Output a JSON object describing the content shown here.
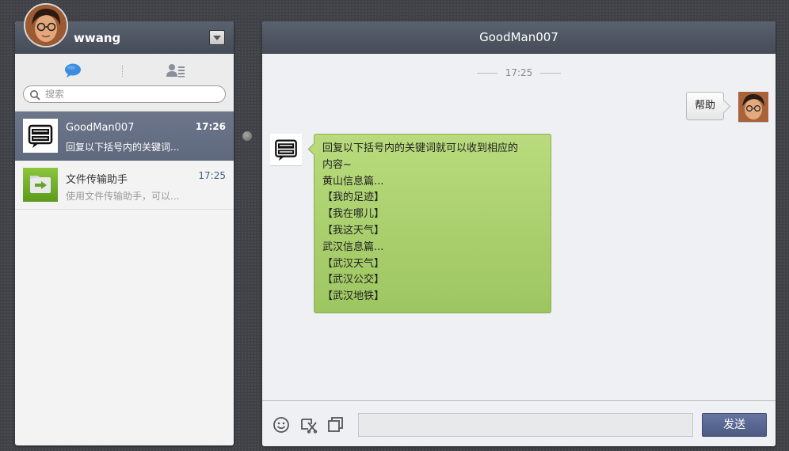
{
  "user": {
    "name": "wwang",
    "avatar_icon": "user-photo-avatar"
  },
  "search": {
    "placeholder": "搜索"
  },
  "tabs": [
    {
      "name": "chat",
      "icon": "speech-bubble-icon",
      "color": "#3b8de0"
    },
    {
      "name": "contacts",
      "icon": "contacts-list-icon",
      "color": "#8a8f99"
    }
  ],
  "conversations": [
    {
      "name": "GoodMan007",
      "time": "17:26",
      "preview": "回复以下括号内的关键词...",
      "avatar_icon": "hello-world-logo",
      "active": true
    },
    {
      "name": "文件传输助手",
      "time": "17:25",
      "preview": "使用文件传输助手，可以...",
      "avatar_icon": "file-transfer-icon",
      "active": false
    }
  ],
  "chat": {
    "title": "GoodMan007",
    "time_divider": "17:25",
    "messages": [
      {
        "from": "me",
        "text": "帮助"
      },
      {
        "from": "bot",
        "lines": [
          "回复以下括号内的关键词就可以收到相应的",
          "内容~",
          "黄山信息篇...",
          "【我的足迹】",
          "【我在哪儿】",
          "【我这天气】",
          "武汉信息篇...",
          "【武汉天气】",
          "【武汉公交】",
          "【武汉地铁】"
        ]
      }
    ]
  },
  "input_bar": {
    "value": "",
    "send_label": "发送",
    "tools": [
      "emoji-icon",
      "screenshot-icon",
      "window-icon"
    ]
  },
  "colors": {
    "header": "#4f5663",
    "active_item": "#666f83",
    "bot_bubble": "#a9cf6d",
    "send_button": "#58668f",
    "accent_time": "#3e5c86"
  }
}
